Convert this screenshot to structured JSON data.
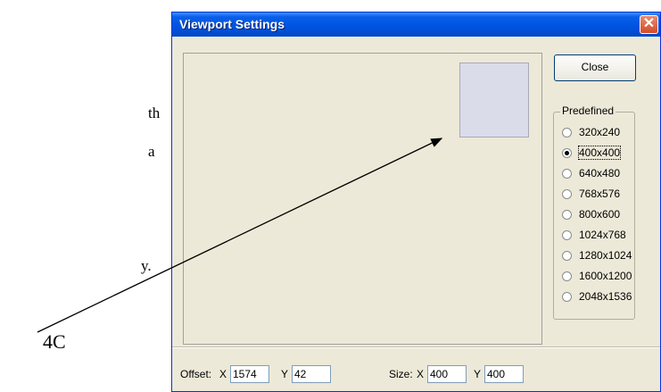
{
  "document": {
    "fragments": [
      "th",
      "a",
      "y."
    ],
    "callout_label": "4C"
  },
  "window": {
    "title": "Viewport Settings",
    "close_glyph": "✕"
  },
  "close_button": {
    "label": "Close"
  },
  "predefined": {
    "label": "Predefined",
    "selected": "400x400",
    "options": [
      "320x240",
      "400x400",
      "640x480",
      "768x576",
      "800x600",
      "1024x768",
      "1280x1024",
      "1600x1200",
      "2048x1536"
    ]
  },
  "offset": {
    "label": "Offset:",
    "x_label": "X",
    "x_value": "1574",
    "y_label": "Y",
    "y_value": "42"
  },
  "size": {
    "label": "Size:",
    "x_label": "X",
    "x_value": "400",
    "y_label": "Y",
    "y_value": "400"
  },
  "colors": {
    "titlebar": "#0054e3",
    "dialog_bg": "#ece9d8",
    "viewport_fill": "#dadcea"
  }
}
